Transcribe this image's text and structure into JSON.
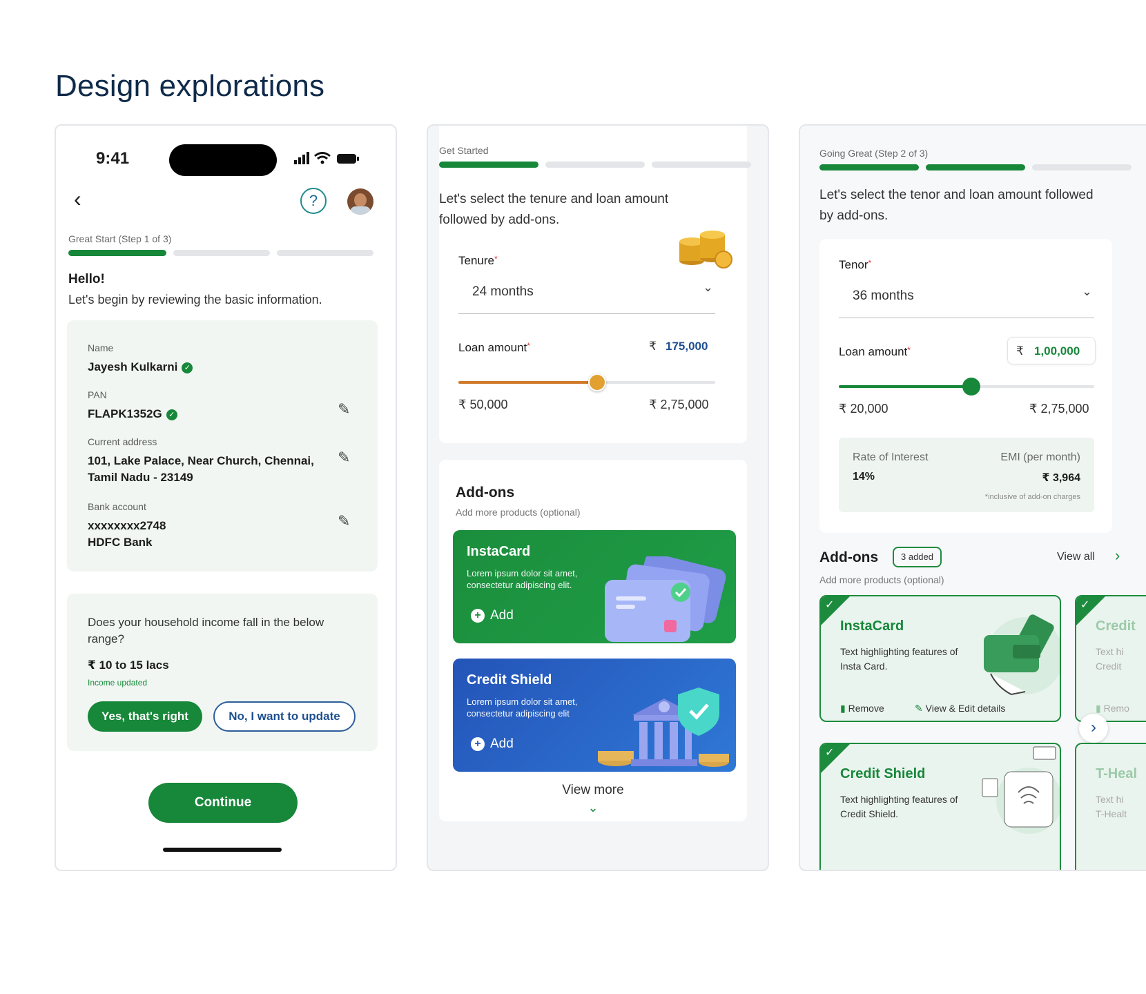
{
  "page": {
    "title": "Design explorations"
  },
  "screen1": {
    "status_time": "9:41",
    "step_label": "Great Start (Step 1 of 3)",
    "greeting": "Hello!",
    "intro": "Let's begin by reviewing the basic information.",
    "name_label": "Name",
    "name_value": "Jayesh Kulkarni",
    "pan_label": "PAN",
    "pan_value": "FLAPK1352G",
    "address_label": "Current address",
    "address_line1": "101, Lake Palace, Near Church, Chennai,",
    "address_line2": "Tamil Nadu - 23149",
    "bank_label": "Bank account",
    "bank_number": "xxxxxxxx2748",
    "bank_name": "HDFC Bank",
    "income_question_line1": "Does your household income fall in the below",
    "income_question_line2": "range?",
    "income_value": "₹ 10 to 15 lacs",
    "income_status": "Income updated",
    "yes_button": "Yes, that's right",
    "no_button": "No, I want to update",
    "continue_button": "Continue",
    "help_glyph": "?",
    "back_glyph": "‹"
  },
  "screen2": {
    "step_label": "Get Started",
    "intro_line1": "Let's select the tenure and loan amount",
    "intro_line2": "followed by add-ons.",
    "tenure_label": "Tenure",
    "required_mark": "*",
    "tenure_value": "24 months",
    "loan_label": "Loan amount",
    "rupee": "₹",
    "loan_value": "175,000",
    "slider_min": "₹ 50,000",
    "slider_max": "₹ 2,75,000",
    "slider_fraction": 0.54,
    "addons_title": "Add-ons",
    "addons_subtitle": "Add more products (optional)",
    "instacard_title": "InstaCard",
    "instacard_desc_line1": "Lorem ipsum dolor sit amet,",
    "instacard_desc_line2": "consectetur adipiscing elit.",
    "creditshield_title": "Credit Shield",
    "creditshield_desc_line1": "Lorem ipsum dolor sit amet,",
    "creditshield_desc_line2": "consectetur adipiscing elit",
    "add_label": "Add",
    "view_more": "View more"
  },
  "screen3": {
    "step_label": "Going Great (Step 2 of 3)",
    "intro_line1": "Let's select the tenor and loan amount followed",
    "intro_line2": "by add-ons.",
    "tenor_label": "Tenor",
    "required_mark": "*",
    "tenor_value": "36 months",
    "loan_label": "Loan amount",
    "rupee": "₹",
    "loan_value": "1,00,000",
    "slider_min": "₹ 20,000",
    "slider_max": "₹ 2,75,000",
    "slider_fraction": 0.52,
    "roi_label": "Rate of Interest",
    "roi_value": "14%",
    "emi_label": "EMI (per month)",
    "emi_value": "₹ 3,964",
    "emi_note": "*inclusive of add-on charges",
    "addons_title": "Add-ons",
    "addons_badge": "3 added",
    "view_all": "View all",
    "addons_subtitle": "Add more products (optional)",
    "instacard_title": "InstaCard",
    "instacard_desc_line1": "Text highlighting features of",
    "instacard_desc_line2": "Insta Card.",
    "remove_label": "Remove",
    "view_edit_label": "View & Edit details",
    "creditshield_title": "Credit Shield",
    "creditshield_desc_line1": "Text highlighting features of",
    "creditshield_desc_line2": "Credit Shield.",
    "peek1_title": "Credit",
    "peek1_desc_line1": "Text hi",
    "peek1_desc_line2": "Credit",
    "peek1_remove": "Remo",
    "peek2_title": "T-Heal",
    "peek2_desc_line1": "Text hi",
    "peek2_desc_line2": "T-Healt"
  },
  "colors": {
    "brand_green": "#17873a",
    "navy": "#0f2a4a",
    "orange": "#d9892b",
    "blue": "#2e6fcf"
  }
}
